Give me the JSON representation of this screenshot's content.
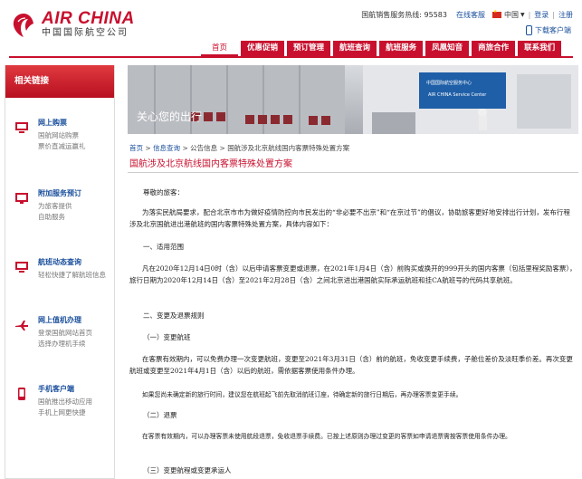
{
  "header": {
    "logo_en": "AIR CHINA",
    "logo_cn": "中国国际航空公司",
    "hotline": "国航销售服务热线: 95583",
    "online_service": "在线客服",
    "region": "中国",
    "login": "登录",
    "register": "注册",
    "download_app": "下载客户端"
  },
  "nav": {
    "items": [
      "首页",
      "优惠促销",
      "预订管理",
      "航班查询",
      "航班服务",
      "凤凰知音",
      "商旅合作",
      "联系我们"
    ]
  },
  "sidebar": {
    "title": "相关链接",
    "items": [
      {
        "label": "网上购票",
        "lines": [
          "国航网站购票",
          "票价直减运赢礼"
        ]
      },
      {
        "label": "附加服务预订",
        "lines": [
          "为旅客提供",
          "自助服务"
        ]
      },
      {
        "label": "航班动态查询",
        "lines": [
          "轻松快捷了解航班信息"
        ]
      },
      {
        "label": "网上值机办理",
        "lines": [
          "登录国航网站首页",
          "选择办理机手续"
        ]
      },
      {
        "label": "手机客户端",
        "lines": [
          "国航推出移动应用",
          "手机上网更快捷"
        ]
      }
    ]
  },
  "banner": {
    "caption": "关心您的出行",
    "sign_cn": "中国国际航空服务中心",
    "sign_en": "AIR CHINA Service Center"
  },
  "breadcrumb": {
    "home": "首页",
    "info": "信息查询",
    "notice": "公告信息",
    "current": "国航涉及北京航线国内客票特殊处置方案",
    "sep": " > "
  },
  "article": {
    "title": "国航涉及北京航线国内客票特殊处置方案",
    "greeting": "尊敬的旅客：",
    "intro": "为落实民航局要求，配合北京市市为做好疫情防控向市民发出的“非必要不出京”和“在京过节”的倡议，协助旅客更好地安排出行计划，发布行程涉及北京国航进出港航班的国内客票特殊处置方案，具体内容如下：",
    "section1": "一、适用范围",
    "scope": "凡在2020年12月14日0时（含）以后申请客票变更或退票，在2021年1月4日（含）前购买或换开的999开头的国内客票（包括里程奖励客票），旅行日期为2020年12月14日（含）至2021年2月28日（含）之间北京进出港国航实际承运航班和挂CA航班号的代码共享航班。",
    "section2": "二、变更及退票规则",
    "sub1": "（一）变更航班",
    "change_rule": "在客票有效期内，可以免费办理一次变更航班，变更至2021年3月31日（含）前的航班，免收变更手续费，子舱位差价及淡旺季价差。再次变更航班或变更至2021年4月1日（含）以后的航班，需依据客票使用条件办理。",
    "change_note": "如果您尚未确定新的旅行时间，建议您在航班起飞前先取消航班订座，待确定新的旅行日期后，再办理客票变更手续。",
    "sub2": "（二）退票",
    "refund_rule": "在客票有效期内，可以办理客票未使用航段退票，免收退票手续费。已按上述原则办理过变更的客票如申请退票需按客票使用条件办理。",
    "sub3": "（三）变更航程或变更承运人"
  },
  "colors": {
    "brand_red": "#c8102e",
    "link_blue": "#1a4f9c"
  }
}
